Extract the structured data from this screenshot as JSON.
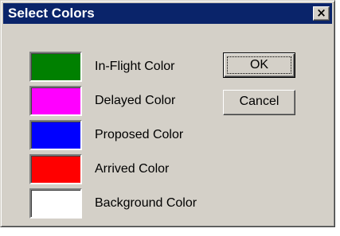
{
  "window": {
    "title": "Select Colors",
    "close_label": "×"
  },
  "colors": [
    {
      "label": "In-Flight Color",
      "swatch": "#008000"
    },
    {
      "label": "Delayed Color",
      "swatch": "#ff00ff"
    },
    {
      "label": "Proposed Color",
      "swatch": "#0000ff"
    },
    {
      "label": "Arrived Color",
      "swatch": "#ff0000"
    },
    {
      "label": "Background Color",
      "swatch": "#ffffff"
    }
  ],
  "buttons": {
    "ok_label": "OK",
    "cancel_label": "Cancel"
  },
  "theme": {
    "face": "#d4d0c8",
    "titlebar": "#0a246a"
  }
}
